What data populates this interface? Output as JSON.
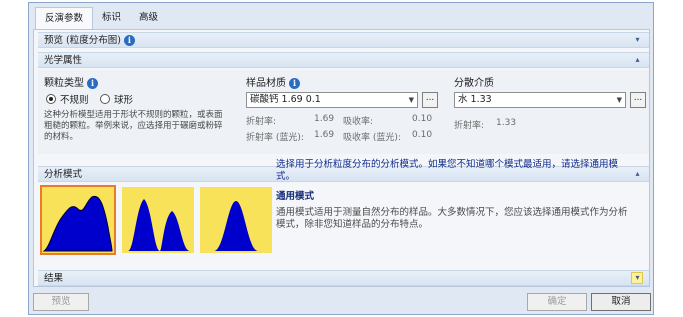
{
  "tabs": [
    {
      "label": "反演参数",
      "active": true
    },
    {
      "label": "标识",
      "active": false
    },
    {
      "label": "高级",
      "active": false
    }
  ],
  "sections": {
    "preview": {
      "title": "预览 (粒度分布图)",
      "state": "collapsed"
    },
    "optical": {
      "title": "光学属性",
      "state": "expanded"
    },
    "analysis_mode": {
      "title": "分析模式",
      "state": "expanded"
    },
    "result": {
      "title": "结果",
      "state": "collapsed"
    }
  },
  "particle_type": {
    "label": "颗粒类型",
    "options": [
      {
        "label": "不规则",
        "selected": true
      },
      {
        "label": "球形",
        "selected": false
      }
    ],
    "description": "这种分析模型适用于形状不规则的颗粒，或表面粗糙的颗粒。举例来说，应选择用于碾磨或粉碎的材料。"
  },
  "sample_material": {
    "label": "样品材质",
    "value": "碳酸钙 1.69 0.1",
    "props": [
      {
        "label": "折射率:",
        "value": "1.69",
        "label2": "吸收率:",
        "value2": "0.10"
      },
      {
        "label": "折射率 (蓝光):",
        "value": "1.69",
        "label2": "吸收率 (蓝光):",
        "value2": "0.10"
      }
    ],
    "more_button": "..."
  },
  "dispersant": {
    "label": "分散介质",
    "value": "水 1.33",
    "props": [
      {
        "label": "折射率:",
        "value": "1.33"
      }
    ],
    "more_button": "..."
  },
  "analysis_mode": {
    "instruction": "选择用于分析粒度分布的分析模式。如果您不知道哪个模式最适用，请选择通用模式。",
    "selected_title": "通用模式",
    "selected_description": "通用模式适用于测量自然分布的样品。大多数情况下，您应该选择通用模式作为分析模式，除非您知道样品的分布特点。",
    "thumbnails": [
      {
        "name": "general-purpose-mode-icon",
        "selected": true
      },
      {
        "name": "multiple-narrow-modes-icon",
        "selected": false
      },
      {
        "name": "single-narrow-mode-icon",
        "selected": false
      }
    ]
  },
  "footer": {
    "preview_label": "预览",
    "ok_label": "确定",
    "cancel_label": "取消"
  },
  "colors": {
    "accent_blue": "#2a6cc0",
    "thumb_fill": "#0000cc",
    "thumb_bg": "#f7e25a",
    "selection_border": "#e87a2a",
    "highlight_chevron": "#fff29a"
  }
}
